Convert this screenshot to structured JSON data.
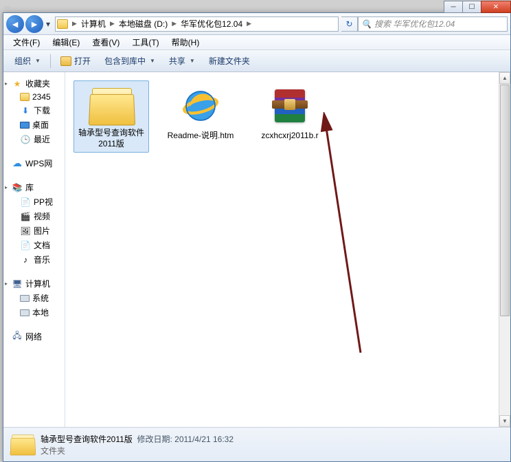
{
  "breadcrumb": {
    "root_icon": "computer",
    "items": [
      "计算机",
      "本地磁盘 (D:)",
      "华军优化包12.04"
    ]
  },
  "search": {
    "placeholder": "搜索 华军优化包12.04"
  },
  "menu": {
    "file": "文件(F)",
    "edit": "编辑(E)",
    "view": "查看(V)",
    "tools": "工具(T)",
    "help": "帮助(H)"
  },
  "toolbar": {
    "organize": "组织",
    "open": "打开",
    "include": "包含到库中",
    "share": "共享",
    "newfolder": "新建文件夹"
  },
  "sidebar": {
    "favorites": {
      "label": "收藏夹",
      "items": [
        "2345",
        "下载",
        "桌面",
        "最近"
      ]
    },
    "wps": {
      "label": "WPS网"
    },
    "libraries": {
      "label": "库",
      "items": [
        "PP视",
        "视频",
        "图片",
        "文档",
        "音乐"
      ]
    },
    "computer": {
      "label": "计算机",
      "items": [
        "系统",
        "本地"
      ]
    },
    "network": {
      "label": "网络"
    }
  },
  "files": {
    "f0": {
      "name": "轴承型号查询软件2011版",
      "type": "folder",
      "selected": true
    },
    "f1": {
      "name": "Readme-说明.htm",
      "type": "htm"
    },
    "f2": {
      "name": "zcxhcxrj2011b.r",
      "type": "rar"
    }
  },
  "status": {
    "name": "轴承型号查询软件2011版",
    "meta_label": "修改日期:",
    "meta_value": "2011/4/21 16:32",
    "type": "文件夹"
  },
  "winbtn": {
    "min": "─",
    "max": "☐",
    "close": "✕"
  }
}
